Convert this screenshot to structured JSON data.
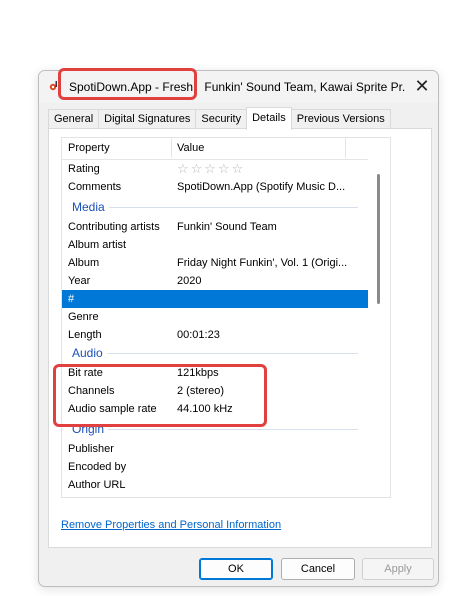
{
  "window": {
    "title_part1": "SpotiDown.App - Fresh",
    "title_part2": "Funkin' Sound Team, Kawai Sprite Pr...",
    "close_glyph": "✕"
  },
  "tabs": [
    "General",
    "Digital Signatures",
    "Security",
    "Details",
    "Previous Versions"
  ],
  "active_tab": "Details",
  "list": {
    "header_property": "Property",
    "header_value": "Value",
    "rating_label": "Rating",
    "rating_stars": "☆☆☆☆☆",
    "comments_label": "Comments",
    "comments_value": "SpotiDown.App (Spotify Music D...",
    "group_media": "Media",
    "contributing_artists_label": "Contributing artists",
    "contributing_artists_value": "Funkin' Sound Team",
    "album_artist_label": "Album artist",
    "album_label": "Album",
    "album_value": "Friday Night Funkin', Vol. 1 (Origi...",
    "year_label": "Year",
    "year_value": "2020",
    "track_label": "#",
    "genre_label": "Genre",
    "length_label": "Length",
    "length_value": "00:01:23",
    "group_audio": "Audio",
    "bitrate_label": "Bit rate",
    "bitrate_value": "121kbps",
    "channels_label": "Channels",
    "channels_value": "2 (stereo)",
    "samplerate_label": "Audio sample rate",
    "samplerate_value": "44.100 kHz",
    "group_origin": "Origin",
    "publisher_label": "Publisher",
    "encoded_by_label": "Encoded by",
    "author_url_label": "Author URL"
  },
  "remove_link": "Remove Properties and Personal Information",
  "buttons": {
    "ok": "OK",
    "cancel": "Cancel",
    "apply": "Apply"
  },
  "colors": {
    "highlight": "#e0413f",
    "selection": "#0078d7",
    "group": "#1a50b8"
  }
}
